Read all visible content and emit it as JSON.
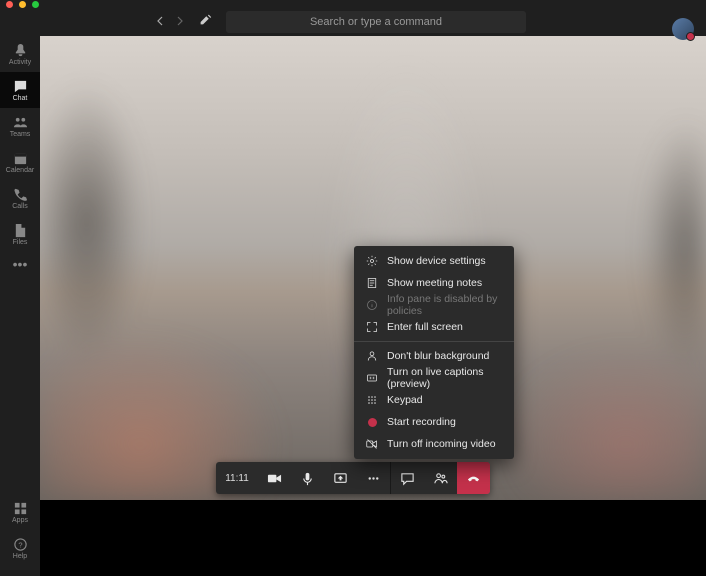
{
  "traffic_lights": {
    "close": "close",
    "min": "minimize",
    "max": "maximize"
  },
  "header": {
    "search_placeholder": "Search or type a command"
  },
  "rail": {
    "items": [
      {
        "label": "Activity"
      },
      {
        "label": "Chat"
      },
      {
        "label": "Teams"
      },
      {
        "label": "Calendar"
      },
      {
        "label": "Calls"
      },
      {
        "label": "Files"
      }
    ],
    "apps_label": "Apps",
    "help_label": "Help"
  },
  "call": {
    "time": "11:11"
  },
  "menu": {
    "items_a": [
      {
        "label": "Show device settings"
      },
      {
        "label": "Show meeting notes"
      },
      {
        "label": "Info pane is disabled by policies",
        "disabled": true
      },
      {
        "label": "Enter full screen"
      }
    ],
    "items_b": [
      {
        "label": "Don't blur background"
      },
      {
        "label": "Turn on live captions (preview)"
      },
      {
        "label": "Keypad"
      },
      {
        "label": "Start recording"
      },
      {
        "label": "Turn off incoming video"
      }
    ]
  }
}
